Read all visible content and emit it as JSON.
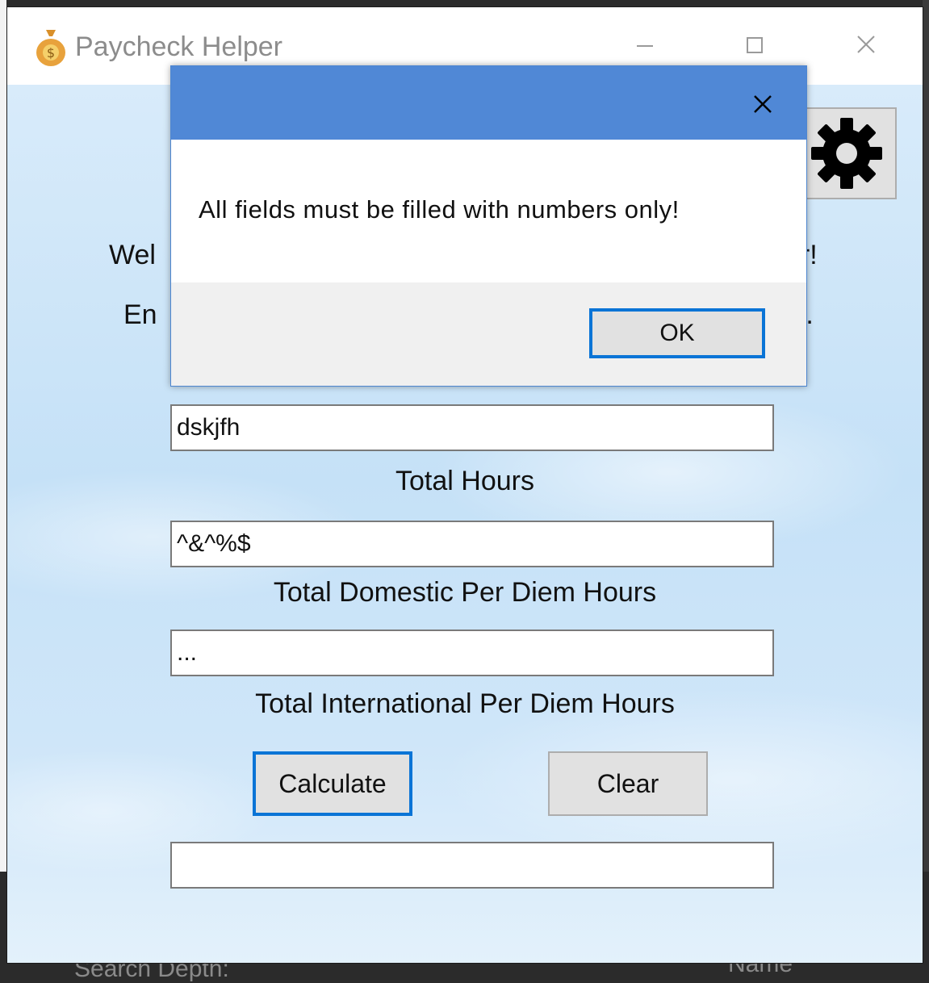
{
  "app": {
    "title": "Paycheck Helper"
  },
  "main": {
    "welcome_start": "Wel",
    "welcome_end": "er!",
    "enter_start": "En",
    "enter_end": ").",
    "fields": [
      {
        "value": "dskjfh",
        "label": "Total Hours"
      },
      {
        "value": "^&^%$",
        "label": "Total Domestic Per Diem Hours"
      },
      {
        "value": "...",
        "label": "Total International Per Diem Hours"
      }
    ],
    "calculate_label": "Calculate",
    "clear_label": "Clear",
    "result_value": ""
  },
  "dialog": {
    "message": "All fields must be filled with numbers only!",
    "ok_label": "OK"
  },
  "background": {
    "search_depth_label": "Search Depth:",
    "name_label": "Name"
  },
  "icons": {
    "app": "money-bag-icon",
    "settings": "gear-icon",
    "close": "close-icon"
  },
  "colors": {
    "dialog_title": "#5088d6",
    "focus_border": "#0a74d6",
    "button_face": "#e1e1e1"
  }
}
